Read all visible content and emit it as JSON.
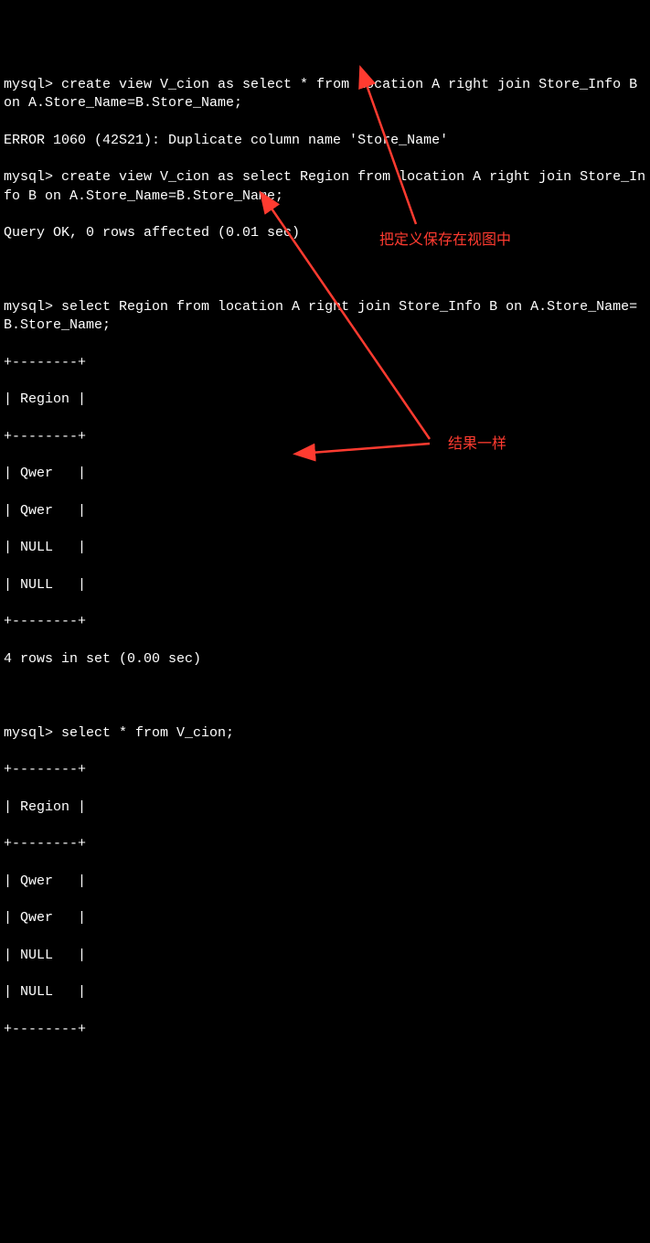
{
  "prompt": "mysql> ",
  "commands": {
    "c1": "create view V_cion as select * from location A right join Store_Info B on A.Store_Name=B.Store_Name;",
    "c1_error": "ERROR 1060 (42S21): Duplicate column name 'Store_Name'",
    "c2": "create view V_cion as select Region from location A right join Store_Info B on A.Store_Name=B.Store_Name;",
    "c2_result": "Query OK, 0 rows affected (0.01 sec)",
    "c3": "select Region from location A right join Store_Info B on A.Store_Name=B.Store_Name;",
    "c4": "select * from V_cion;"
  },
  "table1": {
    "border": "+--------+",
    "header": "| Region |",
    "rows": [
      "| Qwer   |",
      "| Qwer   |",
      "| NULL   |",
      "| NULL   |"
    ],
    "footer": "4 rows in set (0.00 sec)"
  },
  "table2": {
    "border": "+--------+",
    "header": "| Region |",
    "rows": [
      "| Qwer   |",
      "| Qwer   |",
      "| NULL   |",
      "| NULL   |"
    ]
  },
  "annotations": {
    "a1": "把定义保存在视图中",
    "a2": "结果一样"
  },
  "chart_data": {
    "type": "table",
    "title": "Region",
    "queries": [
      {
        "sql": "select Region from location A right join Store_Info B on A.Store_Name=B.Store_Name;",
        "columns": [
          "Region"
        ],
        "rows": [
          [
            "Qwer"
          ],
          [
            "Qwer"
          ],
          [
            null
          ],
          [
            null
          ]
        ],
        "row_count": 4,
        "elapsed_sec": 0.0
      },
      {
        "sql": "select * from V_cion;",
        "columns": [
          "Region"
        ],
        "rows": [
          [
            "Qwer"
          ],
          [
            "Qwer"
          ],
          [
            null
          ],
          [
            null
          ]
        ]
      }
    ]
  }
}
